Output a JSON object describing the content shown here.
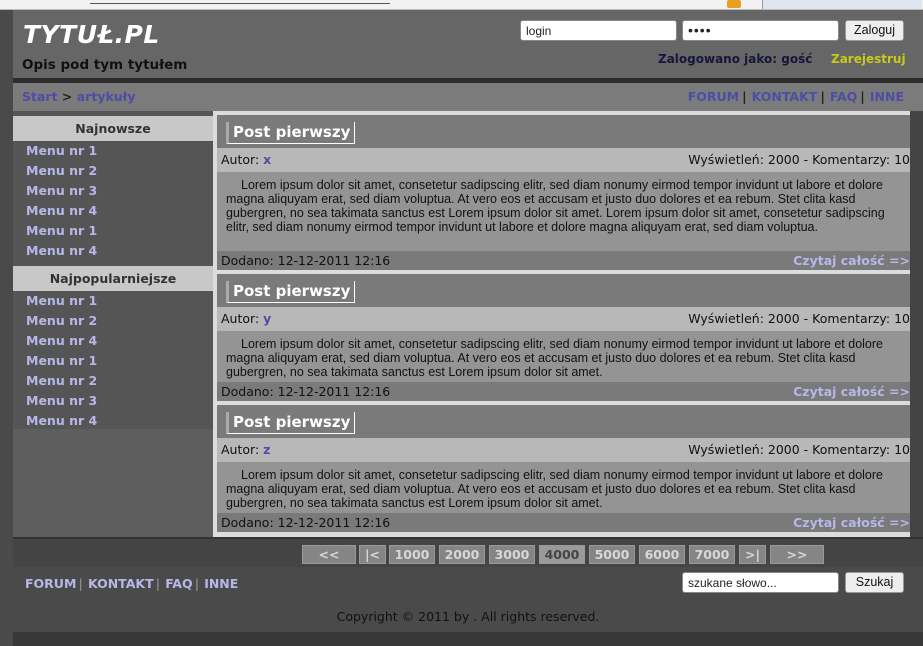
{
  "header": {
    "logo": "TYTUŁ.PL",
    "subtitle": "Opis pod tym tytułem",
    "login_value": "login",
    "password_mask": "••••",
    "login_button": "Zaloguj",
    "logged_as": "Zalogowano jako: gość",
    "register_link": "Zarejestruj"
  },
  "breadcrumb": {
    "start": "Start",
    "separator": " > ",
    "current": "artykuły"
  },
  "top_menu": [
    "FORUM",
    "KONTAKT",
    "FAQ",
    "INNE"
  ],
  "sidebar": {
    "newest_title": "Najnowsze",
    "newest_items": [
      "Menu nr 1",
      "Menu nr 2",
      "Menu nr 3",
      "Menu nr 4",
      "Menu nr 1",
      "Menu nr 4"
    ],
    "popular_title": "Najpopularniejsze",
    "popular_items": [
      "Menu nr 1",
      "Menu nr 2",
      "Menu nr 4",
      "Menu nr 1",
      "Menu nr 2",
      "Menu nr 3",
      "Menu nr 4"
    ]
  },
  "posts": [
    {
      "title": "Post pierwszy",
      "author_label": "Autor:",
      "author": "x",
      "stats": "Wyświetleń: 2000 - Komentarzy: 10",
      "body": "Lorem ipsum dolor sit amet, consetetur sadipscing elitr, sed diam nonumy eirmod tempor invidunt ut labore et dolore magna aliquyam erat, sed diam voluptua. At vero eos et accusam et justo duo dolores et ea rebum. Stet clita kasd gubergren, no sea takimata sanctus est Lorem ipsum dolor sit amet. Lorem ipsum dolor sit amet, consetetur sadipscing elitr, sed diam nonumy eirmod tempor invidunt ut labore et dolore magna aliquyam erat, sed diam voluptua.",
      "added": "Dodano: 12-12-2011 12:16",
      "read_more": "Czytaj całość =>"
    },
    {
      "title": "Post pierwszy",
      "author_label": "Autor:",
      "author": "y",
      "stats": "Wyświetleń: 2000 - Komentarzy: 10",
      "body": "Lorem ipsum dolor sit amet, consetetur sadipscing elitr, sed diam nonumy eirmod tempor invidunt ut labore et dolore magna aliquyam erat, sed diam voluptua. At vero eos et accusam et justo duo dolores et ea rebum. Stet clita kasd gubergren, no sea takimata sanctus est Lorem ipsum dolor sit amet.",
      "added": "Dodano: 12-12-2011 12:16",
      "read_more": "Czytaj całość =>"
    },
    {
      "title": "Post pierwszy",
      "author_label": "Autor:",
      "author": "z",
      "stats": "Wyświetleń: 2000 - Komentarzy: 10",
      "body": "Lorem ipsum dolor sit amet, consetetur sadipscing elitr, sed diam nonumy eirmod tempor invidunt ut labore et dolore magna aliquyam erat, sed diam voluptua. At vero eos et accusam et justo duo dolores et ea rebum. Stet clita kasd gubergren, no sea takimata sanctus est Lorem ipsum dolor sit amet.",
      "added": "Dodano: 12-12-2011 12:16",
      "read_more": "Czytaj całość =>"
    }
  ],
  "pagination": [
    "<<",
    "|<",
    "1000",
    "2000",
    "3000",
    "4000",
    "5000",
    "6000",
    "7000",
    ">|",
    ">>"
  ],
  "pagination_current": "4000",
  "footer": {
    "menu": [
      "FORUM",
      "KONTAKT",
      "FAQ",
      "INNE"
    ],
    "search_value": "szukane słowo...",
    "search_button": "Szukaj",
    "copyright": "Copyright © 2011 by . All rights reserved."
  },
  "colors": {
    "link": "#4d4da6",
    "light_link": "#b8b8e8",
    "register": "#c9c91a",
    "header_bg": "#666666"
  }
}
